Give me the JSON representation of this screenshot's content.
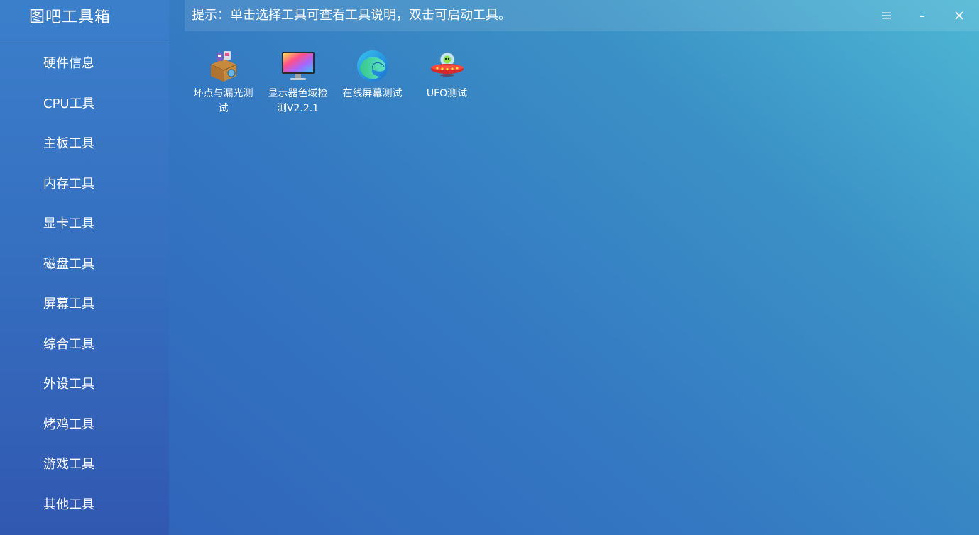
{
  "app": {
    "title": "图吧工具箱"
  },
  "header": {
    "hint": "提示：单击选择工具可查看工具说明，双击可启动工具。",
    "menu_icon": "hamburger-menu-icon",
    "minimize_icon": "minimize-icon",
    "close_icon": "close-icon"
  },
  "sidebar": {
    "items": [
      {
        "label": "硬件信息"
      },
      {
        "label": "CPU工具"
      },
      {
        "label": "主板工具"
      },
      {
        "label": "内存工具"
      },
      {
        "label": "显卡工具"
      },
      {
        "label": "磁盘工具"
      },
      {
        "label": "屏幕工具"
      },
      {
        "label": "综合工具"
      },
      {
        "label": "外设工具"
      },
      {
        "label": "烤鸡工具"
      },
      {
        "label": "游戏工具"
      },
      {
        "label": "其他工具"
      }
    ]
  },
  "tools": [
    {
      "label": "坏点与漏光测试",
      "icon": "box-tools-icon"
    },
    {
      "label": "显示器色域检测V2.2.1",
      "icon": "monitor-color-icon"
    },
    {
      "label": "在线屏幕测试",
      "icon": "edge-browser-icon"
    },
    {
      "label": "UFO测试",
      "icon": "ufo-icon"
    }
  ],
  "colors": {
    "sidebar_top": "#3b7fcb",
    "sidebar_bottom": "#3158b1",
    "main_start": "#2f5fb8",
    "main_end": "#4eb7d4"
  }
}
